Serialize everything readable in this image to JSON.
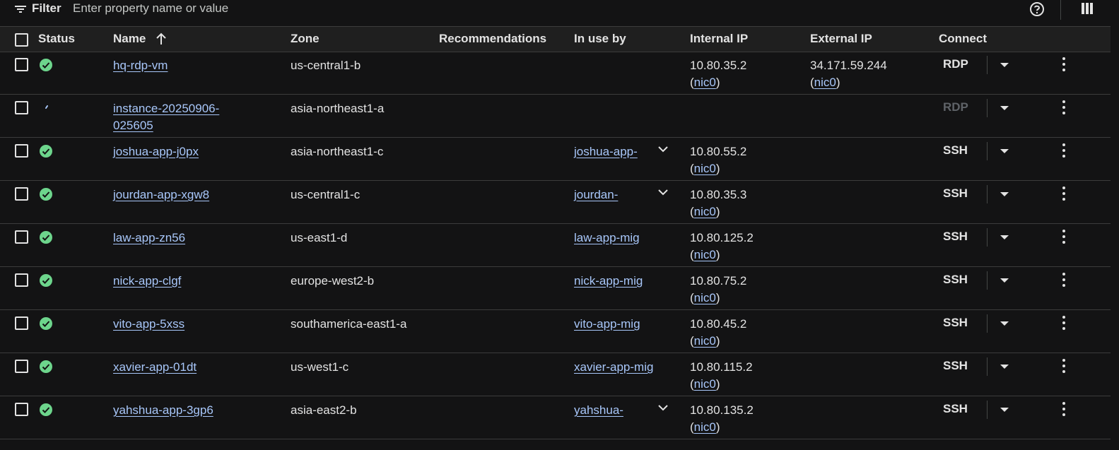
{
  "filter": {
    "label": "Filter",
    "placeholder": "Enter property name or value"
  },
  "columns": {
    "status": "Status",
    "name": "Name",
    "zone": "Zone",
    "recommendations": "Recommendations",
    "in_use_by": "In use by",
    "internal_ip": "Internal IP",
    "external_ip": "External IP",
    "connect": "Connect"
  },
  "colors": {
    "accent_link": "#a8c7fa",
    "status_ok": "#6dd58c",
    "background": "#131314"
  },
  "rows": [
    {
      "name": "hq-rdp-vm",
      "zone": "us-central1-b",
      "in_use_by": "",
      "internal_ip": "10.80.35.2",
      "external_ip": "34.171.59.244",
      "nic": "nic0",
      "connect": "RDP",
      "status": "running"
    },
    {
      "name_line1": "instance-20250906-",
      "name_line2": "025605",
      "zone": "asia-northeast1-a",
      "in_use_by": "",
      "internal_ip": "",
      "external_ip": "",
      "connect": "RDP",
      "status": "starting"
    },
    {
      "name": "joshua-app-j0px",
      "zone": "asia-northeast1-c",
      "in_use_by": "joshua-app-",
      "internal_ip": "10.80.55.2",
      "nic": "nic0",
      "connect": "SSH",
      "status": "running"
    },
    {
      "name": "jourdan-app-xgw8",
      "zone": "us-central1-c",
      "in_use_by": "jourdan-",
      "internal_ip": "10.80.35.3",
      "nic": "nic0",
      "connect": "SSH",
      "status": "running"
    },
    {
      "name": "law-app-zn56",
      "zone": "us-east1-d",
      "in_use_by": "law-app-mig",
      "internal_ip": "10.80.125.2",
      "nic": "nic0",
      "connect": "SSH",
      "status": "running"
    },
    {
      "name": "nick-app-clgf",
      "zone": "europe-west2-b",
      "in_use_by": "nick-app-mig",
      "internal_ip": "10.80.75.2",
      "nic": "nic0",
      "connect": "SSH",
      "status": "running"
    },
    {
      "name": "vito-app-5xss",
      "zone": "southamerica-east1-a",
      "in_use_by": "vito-app-mig",
      "internal_ip": "10.80.45.2",
      "nic": "nic0",
      "connect": "SSH",
      "status": "running"
    },
    {
      "name": "xavier-app-01dt",
      "zone": "us-west1-c",
      "in_use_by": "xavier-app-mig",
      "internal_ip": "10.80.115.2",
      "nic": "nic0",
      "connect": "SSH",
      "status": "running"
    },
    {
      "name": "yahshua-app-3gp6",
      "zone": "asia-east2-b",
      "in_use_by": "yahshua-",
      "internal_ip": "10.80.135.2",
      "nic": "nic0",
      "connect": "SSH",
      "status": "running"
    }
  ]
}
